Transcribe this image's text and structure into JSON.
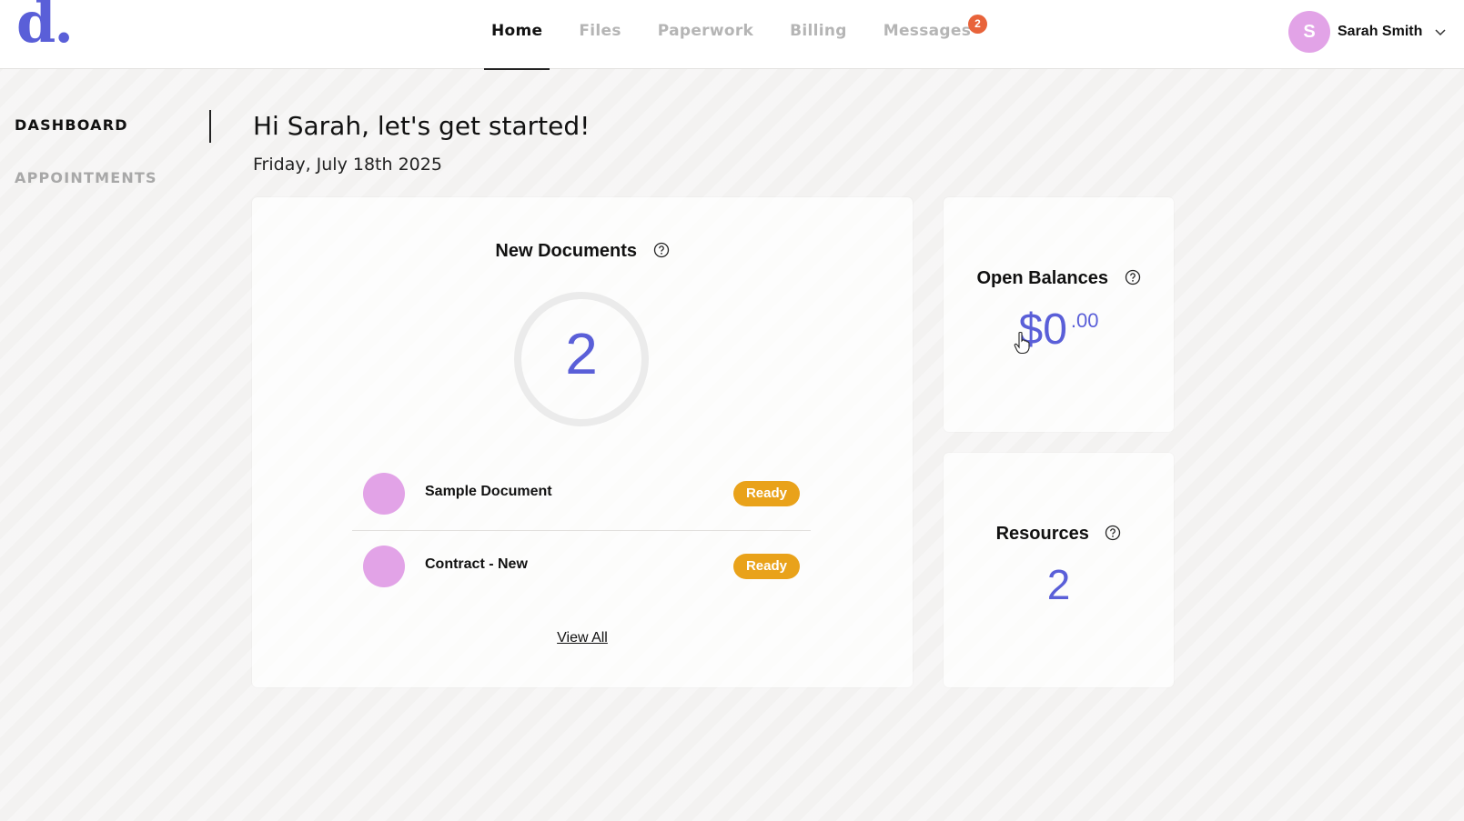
{
  "header": {
    "logo_text": "d.",
    "nav": [
      {
        "label": "Home",
        "active": true
      },
      {
        "label": "Files",
        "active": false
      },
      {
        "label": "Paperwork",
        "active": false
      },
      {
        "label": "Billing",
        "active": false
      },
      {
        "label": "Messages",
        "active": false,
        "badge": "2"
      }
    ],
    "user": {
      "initial": "S",
      "name": "Sarah Smith",
      "dropdown_icon": "chevron-down-icon"
    }
  },
  "sidebar": {
    "items": [
      {
        "label": "DASHBOARD",
        "active": true
      },
      {
        "label": "APPOINTMENTS",
        "active": false
      }
    ]
  },
  "main": {
    "greeting": "Hi Sarah, let's get started!",
    "date": "Friday, July 18th 2025",
    "new_documents": {
      "title": "New Documents",
      "help_icon": "question-circle-icon",
      "count": "2",
      "documents": [
        {
          "name": "Sample Document",
          "status": "Ready"
        },
        {
          "name": "Contract - New",
          "status": "Ready"
        }
      ],
      "view_all_label": "View All"
    },
    "open_balances": {
      "title": "Open Balances",
      "help_icon": "question-circle-icon",
      "amount_major": "$0",
      "amount_minor": ".00"
    },
    "resources": {
      "title": "Resources",
      "help_icon": "question-circle-icon",
      "count": "2"
    }
  },
  "colors": {
    "accent": "#5a5fd8",
    "avatar": "#e2a3e7",
    "status_ready": "#e9a21a",
    "badge": "#e8633a"
  }
}
